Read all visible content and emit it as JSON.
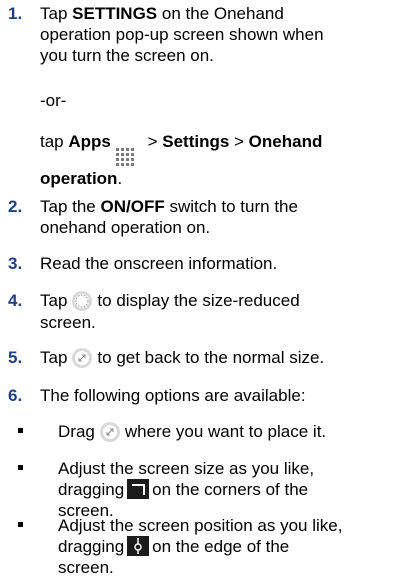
{
  "steps": [
    {
      "number": "1.",
      "lines": [
        {
          "t1": "Tap ",
          "b1": "SETTINGS",
          "t2": " on the Onehand"
        },
        "operation pop-up screen shown when",
        "you turn the screen on."
      ],
      "or": "-or-",
      "alt": {
        "t1": "tap ",
        "b1": "Apps",
        "icon": "apps-grid-icon",
        "t2": " > ",
        "b2": "Settings",
        "t3": " > ",
        "b3": "Onehand",
        "b4": "operation",
        "t4": "."
      }
    },
    {
      "number": "2.",
      "l1": {
        "t1": "Tap the ",
        "b1": "ON/OFF",
        "t2": " switch to turn the"
      },
      "l2": "onehand operation on."
    },
    {
      "number": "3.",
      "l1": "Read the onscreen information."
    },
    {
      "number": "4.",
      "l1a": "Tap",
      "icon": "circle-outline-icon",
      "l1b": "to display the size-reduced",
      "l2": "screen."
    },
    {
      "number": "5.",
      "l1a": "Tap",
      "icon": "resize-arrow-icon",
      "l1b": "to get back to the normal size."
    },
    {
      "number": "6.",
      "l1": "The following options are available:",
      "bullets": [
        {
          "a": "Drag",
          "icon": "resize-arrow-icon",
          "b": "where you want to place it."
        },
        {
          "l1": "Adjust the screen size as you like,",
          "l2a": "dragging",
          "icon": "corner-handle-icon",
          "l2b": "on the corners of the",
          "l3": "screen."
        },
        {
          "l1": "Adjust the screen position as you like,",
          "l2a": "dragging",
          "icon": "edge-handle-icon",
          "l2b": "on the edge of the",
          "l3": "screen."
        }
      ]
    }
  ],
  "colors": {
    "number": "#1f3f86",
    "text": "#000000",
    "icon_dark": "#1b1b1b",
    "icon_gray": "#7a7a7a"
  }
}
